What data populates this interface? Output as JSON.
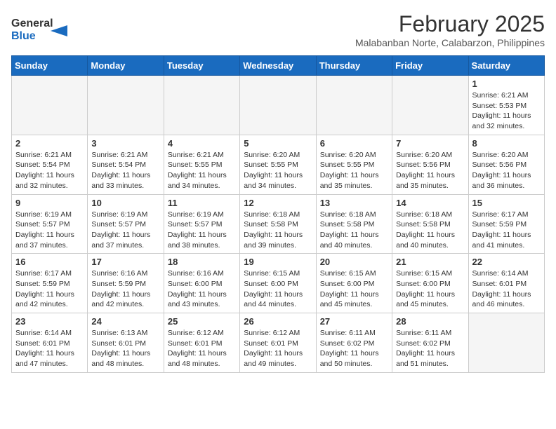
{
  "header": {
    "logo_general": "General",
    "logo_blue": "Blue",
    "month_year": "February 2025",
    "location": "Malabanban Norte, Calabarzon, Philippines"
  },
  "days_of_week": [
    "Sunday",
    "Monday",
    "Tuesday",
    "Wednesday",
    "Thursday",
    "Friday",
    "Saturday"
  ],
  "weeks": [
    [
      {
        "day": "",
        "info": ""
      },
      {
        "day": "",
        "info": ""
      },
      {
        "day": "",
        "info": ""
      },
      {
        "day": "",
        "info": ""
      },
      {
        "day": "",
        "info": ""
      },
      {
        "day": "",
        "info": ""
      },
      {
        "day": "1",
        "info": "Sunrise: 6:21 AM\nSunset: 5:53 PM\nDaylight: 11 hours and 32 minutes."
      }
    ],
    [
      {
        "day": "2",
        "info": "Sunrise: 6:21 AM\nSunset: 5:54 PM\nDaylight: 11 hours and 32 minutes."
      },
      {
        "day": "3",
        "info": "Sunrise: 6:21 AM\nSunset: 5:54 PM\nDaylight: 11 hours and 33 minutes."
      },
      {
        "day": "4",
        "info": "Sunrise: 6:21 AM\nSunset: 5:55 PM\nDaylight: 11 hours and 34 minutes."
      },
      {
        "day": "5",
        "info": "Sunrise: 6:20 AM\nSunset: 5:55 PM\nDaylight: 11 hours and 34 minutes."
      },
      {
        "day": "6",
        "info": "Sunrise: 6:20 AM\nSunset: 5:55 PM\nDaylight: 11 hours and 35 minutes."
      },
      {
        "day": "7",
        "info": "Sunrise: 6:20 AM\nSunset: 5:56 PM\nDaylight: 11 hours and 35 minutes."
      },
      {
        "day": "8",
        "info": "Sunrise: 6:20 AM\nSunset: 5:56 PM\nDaylight: 11 hours and 36 minutes."
      }
    ],
    [
      {
        "day": "9",
        "info": "Sunrise: 6:19 AM\nSunset: 5:57 PM\nDaylight: 11 hours and 37 minutes."
      },
      {
        "day": "10",
        "info": "Sunrise: 6:19 AM\nSunset: 5:57 PM\nDaylight: 11 hours and 37 minutes."
      },
      {
        "day": "11",
        "info": "Sunrise: 6:19 AM\nSunset: 5:57 PM\nDaylight: 11 hours and 38 minutes."
      },
      {
        "day": "12",
        "info": "Sunrise: 6:18 AM\nSunset: 5:58 PM\nDaylight: 11 hours and 39 minutes."
      },
      {
        "day": "13",
        "info": "Sunrise: 6:18 AM\nSunset: 5:58 PM\nDaylight: 11 hours and 40 minutes."
      },
      {
        "day": "14",
        "info": "Sunrise: 6:18 AM\nSunset: 5:58 PM\nDaylight: 11 hours and 40 minutes."
      },
      {
        "day": "15",
        "info": "Sunrise: 6:17 AM\nSunset: 5:59 PM\nDaylight: 11 hours and 41 minutes."
      }
    ],
    [
      {
        "day": "16",
        "info": "Sunrise: 6:17 AM\nSunset: 5:59 PM\nDaylight: 11 hours and 42 minutes."
      },
      {
        "day": "17",
        "info": "Sunrise: 6:16 AM\nSunset: 5:59 PM\nDaylight: 11 hours and 42 minutes."
      },
      {
        "day": "18",
        "info": "Sunrise: 6:16 AM\nSunset: 6:00 PM\nDaylight: 11 hours and 43 minutes."
      },
      {
        "day": "19",
        "info": "Sunrise: 6:15 AM\nSunset: 6:00 PM\nDaylight: 11 hours and 44 minutes."
      },
      {
        "day": "20",
        "info": "Sunrise: 6:15 AM\nSunset: 6:00 PM\nDaylight: 11 hours and 45 minutes."
      },
      {
        "day": "21",
        "info": "Sunrise: 6:15 AM\nSunset: 6:00 PM\nDaylight: 11 hours and 45 minutes."
      },
      {
        "day": "22",
        "info": "Sunrise: 6:14 AM\nSunset: 6:01 PM\nDaylight: 11 hours and 46 minutes."
      }
    ],
    [
      {
        "day": "23",
        "info": "Sunrise: 6:14 AM\nSunset: 6:01 PM\nDaylight: 11 hours and 47 minutes."
      },
      {
        "day": "24",
        "info": "Sunrise: 6:13 AM\nSunset: 6:01 PM\nDaylight: 11 hours and 48 minutes."
      },
      {
        "day": "25",
        "info": "Sunrise: 6:12 AM\nSunset: 6:01 PM\nDaylight: 11 hours and 48 minutes."
      },
      {
        "day": "26",
        "info": "Sunrise: 6:12 AM\nSunset: 6:01 PM\nDaylight: 11 hours and 49 minutes."
      },
      {
        "day": "27",
        "info": "Sunrise: 6:11 AM\nSunset: 6:02 PM\nDaylight: 11 hours and 50 minutes."
      },
      {
        "day": "28",
        "info": "Sunrise: 6:11 AM\nSunset: 6:02 PM\nDaylight: 11 hours and 51 minutes."
      },
      {
        "day": "",
        "info": ""
      }
    ]
  ]
}
